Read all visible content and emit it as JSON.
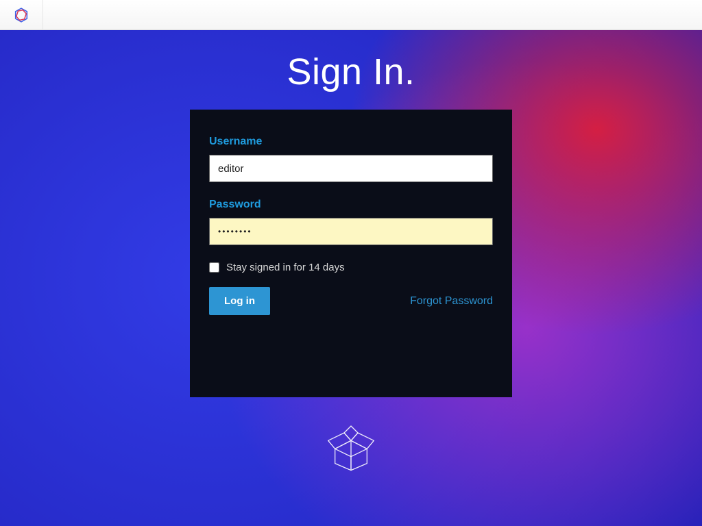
{
  "page": {
    "title": "Sign In."
  },
  "form": {
    "username": {
      "label": "Username",
      "value": "editor"
    },
    "password": {
      "label": "Password",
      "value": "••••••••"
    },
    "stay_signed_in": {
      "label": "Stay signed in for 14 days",
      "checked": false
    },
    "submit_label": "Log in",
    "forgot_label": "Forgot Password"
  }
}
